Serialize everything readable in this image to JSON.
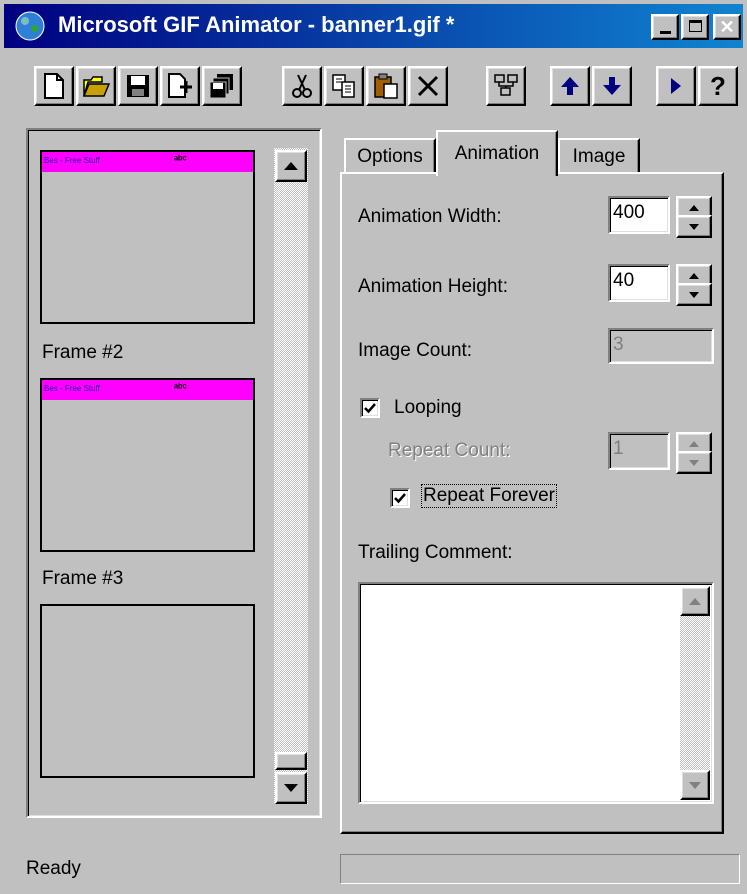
{
  "window": {
    "title": "Microsoft GIF Animator - banner1.gif *",
    "buttons": {
      "minimize": "_",
      "maximize": "□",
      "close": "✕"
    }
  },
  "toolbar": {
    "buttons": [
      "new-file",
      "open",
      "save",
      "insert",
      "save-as",
      "cut",
      "copy",
      "paste",
      "delete",
      "select-all",
      "move-up",
      "move-down",
      "preview",
      "help"
    ],
    "help_label": "?"
  },
  "frames": [
    {
      "label": "Frame #2",
      "banner": "Bes - Free Stuff",
      "logo": "ᵃᵇᶜ"
    },
    {
      "label": "Frame #3",
      "banner": "Bes - Free Stuff",
      "logo": "ᵃᵇᶜ"
    },
    {
      "label": "",
      "banner": "",
      "logo": ""
    }
  ],
  "tabs": [
    {
      "label": "Options",
      "active": false
    },
    {
      "label": "Animation",
      "active": true
    },
    {
      "label": "Image",
      "active": false
    }
  ],
  "animation": {
    "width_label": "Animation Width:",
    "width_value": "400",
    "height_label": "Animation Height:",
    "height_value": "40",
    "count_label": "Image Count:",
    "count_value": "3",
    "looping_label": "Looping",
    "looping_checked": true,
    "repeat_count_label": "Repeat Count:",
    "repeat_count_value": "1",
    "repeat_forever_label": "Repeat Forever",
    "repeat_forever_checked": true,
    "comment_label": "Trailing Comment:",
    "comment_value": ""
  },
  "status": {
    "text": "Ready"
  },
  "colors": {
    "titlebar_start": "#000080",
    "titlebar_end": "#1084d0",
    "banner": "#ff00ff",
    "face": "#c0c0c0"
  }
}
